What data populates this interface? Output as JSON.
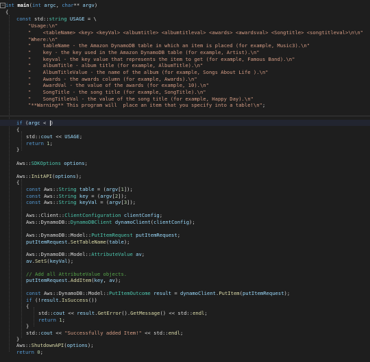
{
  "editor": {
    "lines": [
      "int main(int argc, char** argv)",
      "{",
      "const std::string USAGE = \\",
      "\"Usage:\\n\"",
      "\"    <tableName> <key> <keyVal> <albumtitle> <albumtitleval> <awards> <awardsval> <Songtitle> <songtitleval>\\n\\n\"",
      "\"Where:\\n\"",
      "\"    tableName - the Amazon DynamoDB table in which an item is placed (for example, Music3).\\n\"",
      "\"    key - the key used in the Amazon DynamoDB table (for example, Artist).\\n\"",
      "\"    keyval - the key value that represents the item to get (for example, Famous Band).\\n\"",
      "\"    albumTitle - album title (for example, AlbumTitle).\\n\"",
      "\"    AlbumTitleValue - the name of the album (for example, Songs About Life ).\\n\"",
      "\"    Awards - the awards column (for example, Awards).\\n\"",
      "\"    AwardVal - the value of the awards (for example, 10).\\n\"",
      "\"    SongTitle - the song title (for example, SongTitle).\\n\"",
      "\"    SongTitleVal - the value of the song title (for example, Happy Day).\\n\"",
      "\"**Warning** This program will  place an item that you specify into a table!\\n\";",
      "if (argc < )",
      "{",
      "std::cout << USAGE;",
      "return 1;",
      "}",
      "Aws::SDKOptions options;",
      "Aws::InitAPI(options);",
      "{",
      "const Aws::String table = (argv[1]);",
      "const Aws::String key = (argv[2]);",
      "const Aws::String keyVal = (argv[3]);",
      "Aws::Client::ClientConfiguration clientConfig;",
      "Aws::DynamoDB::DynamoDBClient dynamoClient(clientConfig);",
      "Aws::DynamoDB::Model::PutItemRequest putItemRequest;",
      "putItemRequest.SetTableName(table);",
      "Aws::DynamoDB::Model::AttributeValue av;",
      "av.SetS(keyVal);",
      "// Add all AttributeValue objects.",
      "putItemRequest.AddItem(key, av);",
      "const Aws::DynamoDB::Model::PutItemOutcome result = dynamoClient.PutItem(putItemRequest);",
      "if (!result.IsSuccess())",
      "{",
      "std::cout << result.GetError().GetMessage() << std::endl;",
      "return 1;",
      "}",
      "std::cout << \"Successfully added Item!\" << std::endl;",
      "}",
      "Aws::ShutdownAPI(options);",
      "return 0;"
    ]
  }
}
